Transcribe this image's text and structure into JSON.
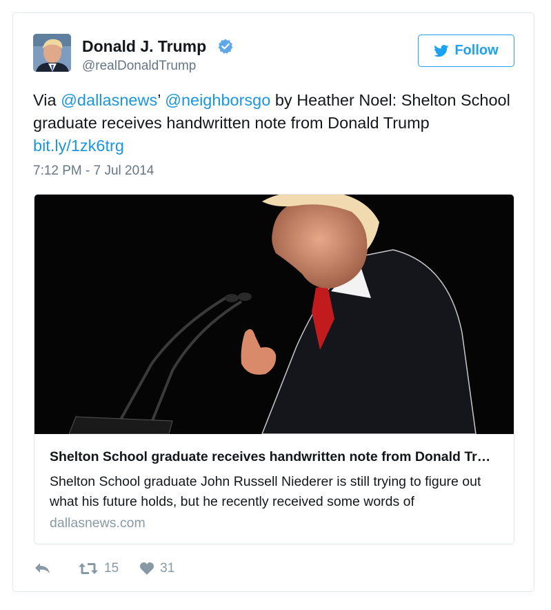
{
  "author": {
    "name": "Donald J. Trump",
    "handle": "@realDonaldTrump",
    "verified": true
  },
  "follow_button": {
    "label": "Follow",
    "icon": "twitter-bird-icon"
  },
  "tweet": {
    "prefix": "Via ",
    "mention1": "@dallasnews",
    "apostrophe": "’ ",
    "mention2": "@neighborsgo",
    "body": " by Heather Noel: Shelton School graduate receives handwritten note from Donald Trump ",
    "link": "bit.ly/1zk6trg",
    "timestamp": "7:12 PM - 7 Jul 2014"
  },
  "card": {
    "title": "Shelton School graduate receives handwritten note from Donald Trump",
    "description": "Shelton School graduate John Russell Niederer is still trying to figure out what his future holds, but he recently received some words of",
    "domain": "dallasnews.com"
  },
  "actions": {
    "reply_icon": "reply-icon",
    "retweet_icon": "retweet-icon",
    "retweet_count": "15",
    "like_icon": "heart-icon",
    "like_count": "31"
  },
  "colors": {
    "link": "#1b95e0",
    "brand": "#1da1f2",
    "muted": "#657786",
    "border": "#e1e8ed"
  }
}
